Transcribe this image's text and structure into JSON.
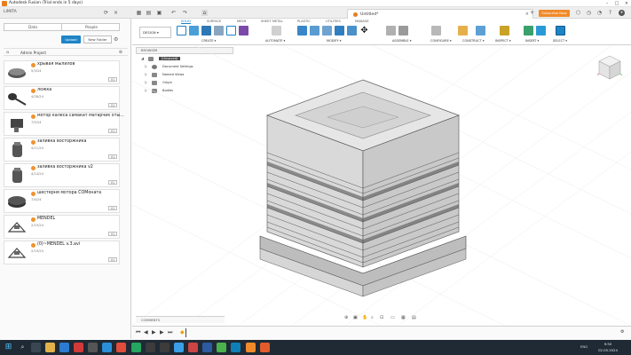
{
  "window": {
    "title": "Autodesk Fusion (Trial ends in 5 days)"
  },
  "team": {
    "name": "LIMITA"
  },
  "document": {
    "title": "Untitled*"
  },
  "subscribe": {
    "label": "Subscribe Now"
  },
  "left_panel": {
    "tabs": [
      "Data",
      "People"
    ],
    "upload_label": "Upload",
    "new_folder_label": "New Folder",
    "project_name": "Admin Project",
    "files": [
      {
        "name": "хрывая мылилов",
        "date": "5/3/24",
        "version": "V1"
      },
      {
        "name": "ложка",
        "date": "4/28/24",
        "version": "V1"
      },
      {
        "name": "мотор калеса самакат матарчик оты...",
        "date": "7/5/24",
        "version": "V1"
      },
      {
        "name": "заливка восторжника",
        "date": "4/11/24",
        "version": "V1"
      },
      {
        "name": "заливка восторжника v2",
        "date": "4/14/24",
        "version": "V1"
      },
      {
        "name": "шестерня мотора СОМоната",
        "date": "7/4/24",
        "version": "V1"
      },
      {
        "name": "MENDEL",
        "date": "2/19/24",
        "version": "V1"
      },
      {
        "name": "(0)~MENDEL v.3.avi",
        "date": "2/19/24",
        "version": "V1"
      }
    ]
  },
  "toolbar": {
    "design_label": "DESIGN",
    "tabs": [
      "SOLID",
      "SURFACE",
      "MESH",
      "SHEET METAL",
      "PLASTIC",
      "UTILITIES",
      "MANAGE"
    ],
    "groups": [
      "CREATE",
      "AUTOMATE",
      "MODIFY",
      "ASSEMBLE",
      "CONFIGURE",
      "CONSTRUCT",
      "INSPECT",
      "INSERT",
      "SELECT"
    ]
  },
  "browser": {
    "title": "BROWSER",
    "root_label": "(Unsaved)",
    "items": [
      "Document Settings",
      "Named Views",
      "Origin",
      "Bodies"
    ]
  },
  "comments": {
    "label": "COMMENTS"
  },
  "taskbar": {
    "lang": "ENG",
    "time": "9:50",
    "date": "02.05.2024"
  },
  "colors": {
    "accent": "#1d84c6",
    "orange": "#f08a2a",
    "taskbar": "#1f2a34"
  }
}
